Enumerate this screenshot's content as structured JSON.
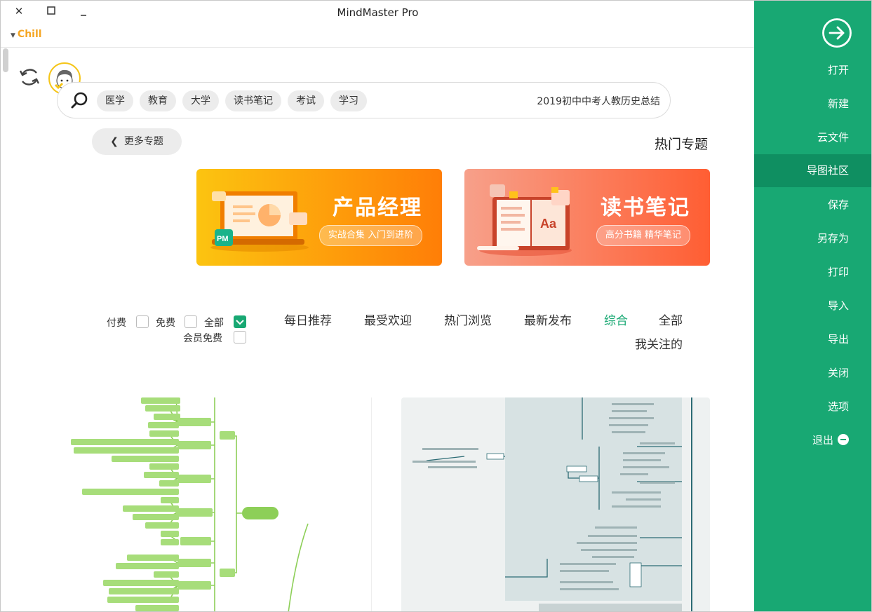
{
  "window": {
    "title": "MindMaster Pro",
    "theme_label": "Chill"
  },
  "sidebar": {
    "items": [
      {
        "label": "打开"
      },
      {
        "label": "新建"
      },
      {
        "label": "云文件"
      },
      {
        "label": "导图社区"
      },
      {
        "label": "保存"
      },
      {
        "label": "另存为"
      },
      {
        "label": "打印"
      },
      {
        "label": "导入"
      },
      {
        "label": "导出"
      },
      {
        "label": "关闭"
      },
      {
        "label": "选项"
      },
      {
        "label": "退出"
      }
    ],
    "active_index": 3,
    "accent": "#18a873"
  },
  "search": {
    "value": "2019初中中考人教历史总结",
    "tags": [
      "学习",
      "考试",
      "读书笔记",
      "大学",
      "教育",
      "医学"
    ]
  },
  "section": {
    "title": "热门专题",
    "more_label": "更多专题"
  },
  "banners": [
    {
      "title": "读书笔记",
      "subtitle": "高分书籍 精华笔记",
      "badge": "Aa",
      "color": "#fa6e46"
    },
    {
      "title": "产品经理",
      "subtitle": "实战合集 入门到进阶",
      "badge": "PM",
      "color": "#fb9a0a"
    }
  ],
  "filters": {
    "tabs": [
      "全部",
      "综合",
      "最新发布",
      "热门浏览",
      "最受欢迎",
      "每日推荐",
      "我关注的"
    ],
    "active_tab": "综合",
    "checkboxes": [
      {
        "label": "全部",
        "checked": true
      },
      {
        "label": "免费",
        "checked": false
      },
      {
        "label": "付费",
        "checked": false
      },
      {
        "label": "会员免费",
        "checked": false
      }
    ]
  }
}
